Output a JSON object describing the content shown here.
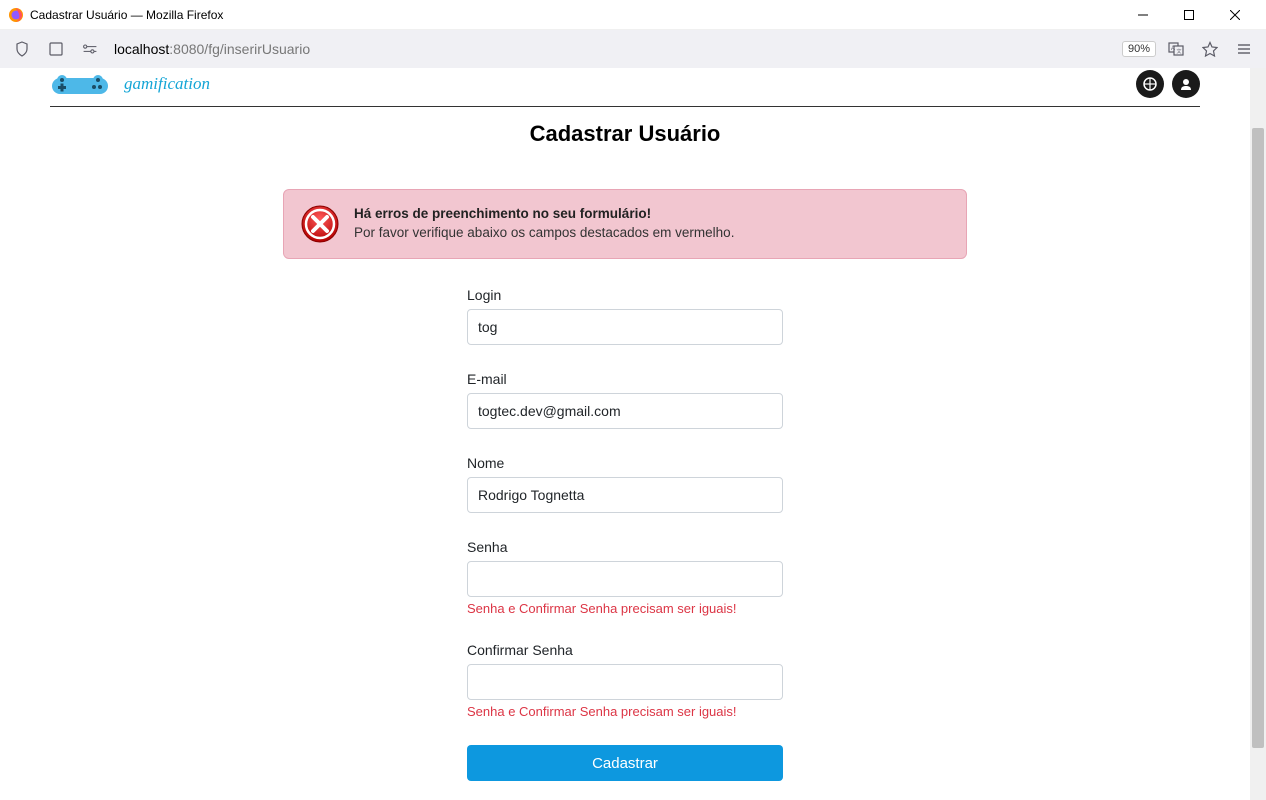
{
  "window": {
    "title": "Cadastrar Usuário — Mozilla Firefox"
  },
  "toolbar": {
    "url_host": "localhost",
    "url_port_path": ":8080/fg/inserirUsuario",
    "zoom": "90%"
  },
  "page": {
    "logo_text": "gamification",
    "title": "Cadastrar Usuário"
  },
  "alert": {
    "heading": "Há erros de preenchimento no seu formulário!",
    "body": "Por favor verifique abaixo os campos destacados em vermelho."
  },
  "form": {
    "login": {
      "label": "Login",
      "value": "tog"
    },
    "email": {
      "label": "E-mail",
      "value": "togtec.dev@gmail.com"
    },
    "nome": {
      "label": "Nome",
      "value": "Rodrigo Tognetta"
    },
    "senha": {
      "label": "Senha",
      "value": "",
      "error": "Senha e Confirmar Senha precisam ser iguais!"
    },
    "confirmar_senha": {
      "label": "Confirmar Senha",
      "value": "",
      "error": "Senha e Confirmar Senha precisam ser iguais!"
    },
    "submit_label": "Cadastrar"
  }
}
